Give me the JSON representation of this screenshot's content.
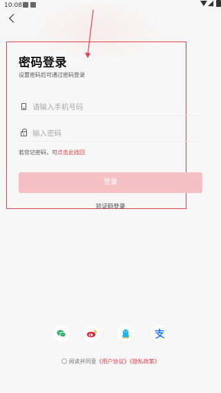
{
  "status_bar": {
    "time": "10:08"
  },
  "page": {
    "title": "密码登录",
    "subtitle": "设置密码后可通过密码登录"
  },
  "form": {
    "phone_placeholder": "请输入手机号码",
    "password_placeholder": "输入密码",
    "phone_value": "",
    "password_value": ""
  },
  "forgot": {
    "prefix": "若您记密码，可",
    "link": "点击此找回"
  },
  "login_button": {
    "label": "登录"
  },
  "alt_login": {
    "label": "验证码登录"
  },
  "third_party": [
    "wechat-icon",
    "weibo-icon",
    "qq-icon",
    "alipay-icon"
  ],
  "agreement": {
    "prefix": "阅读并同意",
    "user_agreement": "《用户协议》",
    "privacy_policy": "《隐私政策》"
  },
  "colors": {
    "accent": "#e8404a",
    "button_bg": "#f5c0c3",
    "wechat": "#2aae67",
    "weibo": "#e6162d",
    "qq": "#12b7f5",
    "alipay": "#1677ff"
  }
}
